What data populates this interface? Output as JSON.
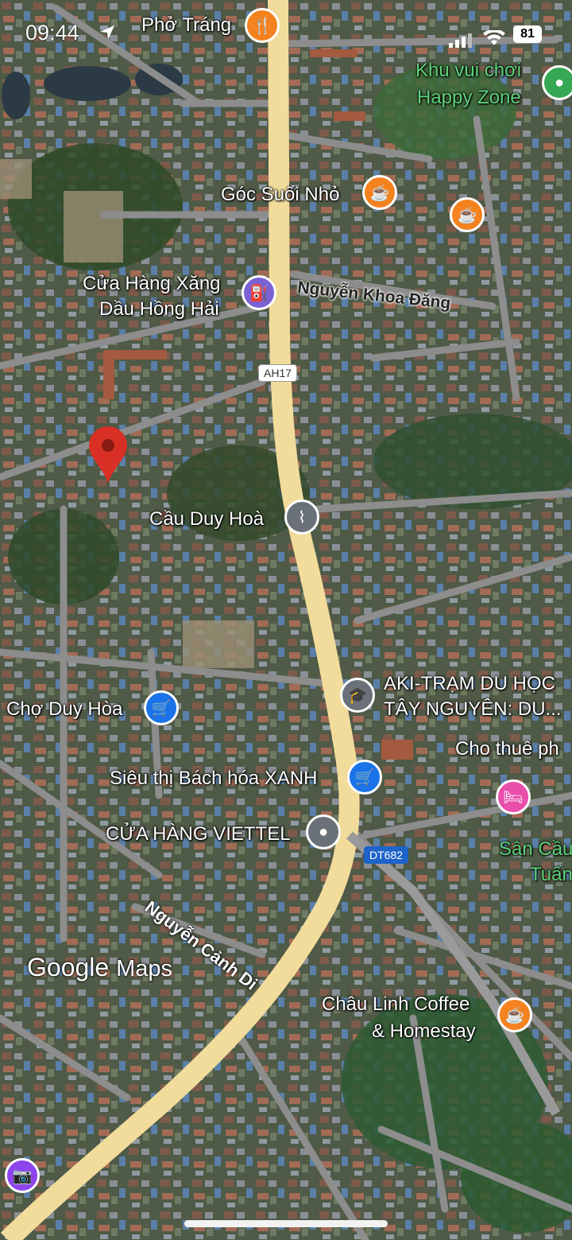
{
  "status_bar": {
    "time": "09:44",
    "battery": "81"
  },
  "pois": {
    "pho_trang": "Phở Tráng",
    "happy_zone_1": "Khu vui chơi",
    "happy_zone_2": "Happy Zone",
    "goc_suoi_nho": "Góc Suối Nhỏ",
    "xang_1": "Cửa Hàng Xăng",
    "xang_2": "Dầu Hồng Hải",
    "cau_duy_hoa": "Cầu Duy Hoà",
    "aki_1": "AKI-TRẠM DU HỌC",
    "aki_2": "TÂY NGUYÊN: DU...",
    "cho_duy_hoa": "Chợ Duy Hòa",
    "cho_thue": "Cho thuê ph",
    "bach_hoa": "Siêu thị Bách hóa XANH",
    "viettel": "CỬA HÀNG VIETTEL",
    "san_cau_1": "Sân Cầu",
    "san_cau_2": "Tuấn",
    "chau_linh_1": "Châu Linh Coffee",
    "chau_linh_2": "& Homestay"
  },
  "roads": {
    "nguyen_khoa_dang": "Nguyễn Khoa Đăng",
    "nguyen_canh_di": "Nguyễn Cảnh Di",
    "ah17": "AH17",
    "dt682": "DT682"
  },
  "watermark": {
    "google": "Google",
    "maps": "Maps"
  },
  "icons": [
    "navigation-arrow-icon",
    "cellular-signal-icon",
    "wifi-icon",
    "restaurant-icon",
    "cafe-icon",
    "gas-station-icon",
    "bridge-icon",
    "school-icon",
    "shopping-cart-icon",
    "location-dot-icon",
    "hotel-icon",
    "park-icon",
    "dropped-pin-icon",
    "add-photo-icon"
  ],
  "colors": {
    "highway": "#f2dc9b",
    "road": "#8d8d8d",
    "food": "#f4821f",
    "shop": "#1a73e8",
    "landmark": "#6b7178",
    "lodging": "#e84eaa",
    "park": "#34a853",
    "pin": "#d93025",
    "fuel": "#7b62d4"
  }
}
